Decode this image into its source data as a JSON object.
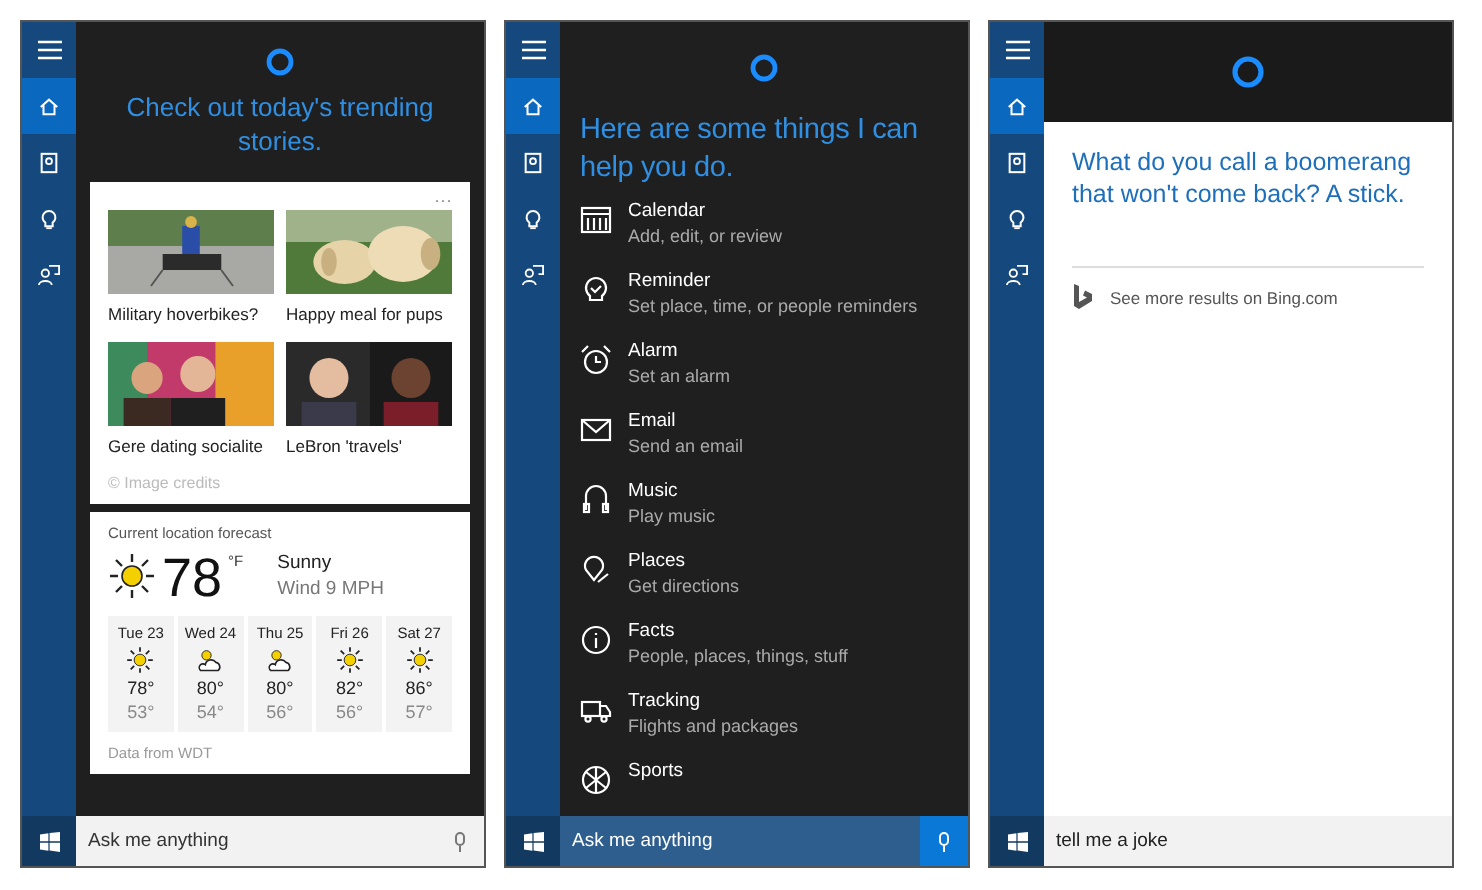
{
  "panels": [
    {
      "kind": "trending",
      "sidebar": [
        {
          "kind": "home",
          "selected": true
        },
        {
          "kind": "notebook",
          "selected": false
        },
        {
          "kind": "interests",
          "selected": false
        },
        {
          "kind": "feedback",
          "selected": false
        }
      ],
      "heading": "Check out today's trending stories.",
      "news": {
        "more": "···",
        "stories": [
          {
            "caption": "Military hoverbikes?"
          },
          {
            "caption": "Happy meal for pups"
          },
          {
            "caption": "Gere dating socialite"
          },
          {
            "caption": "LeBron 'travels'"
          }
        ],
        "credits": "© Image credits"
      },
      "weather": {
        "title": "Current location forecast",
        "kind": "sunny",
        "temperature": "78",
        "unit": "°F",
        "condition": "Sunny",
        "wind": "Wind 9 MPH",
        "days": [
          {
            "day": "Tue 23",
            "kind": "sunny",
            "high": "78°",
            "low": "53°"
          },
          {
            "day": "Wed 24",
            "kind": "partly_cloudy",
            "high": "80°",
            "low": "54°"
          },
          {
            "day": "Thu 25",
            "kind": "partly_cloudy",
            "high": "80°",
            "low": "56°"
          },
          {
            "day": "Fri 26",
            "kind": "sunny",
            "high": "82°",
            "low": "56°"
          },
          {
            "day": "Sat 27",
            "kind": "sunny",
            "high": "86°",
            "low": "57°"
          }
        ],
        "source": "Data from WDT"
      },
      "search": {
        "placeholder": "Ask me anything",
        "highlighted": false
      }
    },
    {
      "kind": "help",
      "sidebar": [
        {
          "kind": "home",
          "selected": true
        },
        {
          "kind": "notebook",
          "selected": false
        },
        {
          "kind": "interests",
          "selected": false
        },
        {
          "kind": "feedback",
          "selected": false
        }
      ],
      "heading": "Here are some things I can help you do.",
      "items": [
        {
          "kind": "calendar",
          "title": "Calendar",
          "subtitle": "Add, edit, or review"
        },
        {
          "kind": "reminder",
          "title": "Reminder",
          "subtitle": "Set place, time, or people reminders"
        },
        {
          "kind": "alarm",
          "title": "Alarm",
          "subtitle": "Set an alarm"
        },
        {
          "kind": "email",
          "title": "Email",
          "subtitle": "Send an email"
        },
        {
          "kind": "music",
          "title": "Music",
          "subtitle": "Play music"
        },
        {
          "kind": "places",
          "title": "Places",
          "subtitle": "Get directions"
        },
        {
          "kind": "facts",
          "title": "Facts",
          "subtitle": "People, places, things, stuff"
        },
        {
          "kind": "tracking",
          "title": "Tracking",
          "subtitle": "Flights and packages"
        },
        {
          "kind": "sports",
          "title": "Sports"
        }
      ],
      "search": {
        "placeholder": "Ask me anything",
        "highlighted": true
      }
    },
    {
      "kind": "answer",
      "sidebar": [
        {
          "kind": "home",
          "selected": true
        },
        {
          "kind": "notebook",
          "selected": false
        },
        {
          "kind": "interests",
          "selected": false
        },
        {
          "kind": "feedback",
          "selected": false
        }
      ],
      "answer": "What do you call a boomerang that won't come back? A stick.",
      "link": "See more results on Bing.com",
      "search": {
        "value": "tell me a joke",
        "highlighted": false
      }
    }
  ]
}
